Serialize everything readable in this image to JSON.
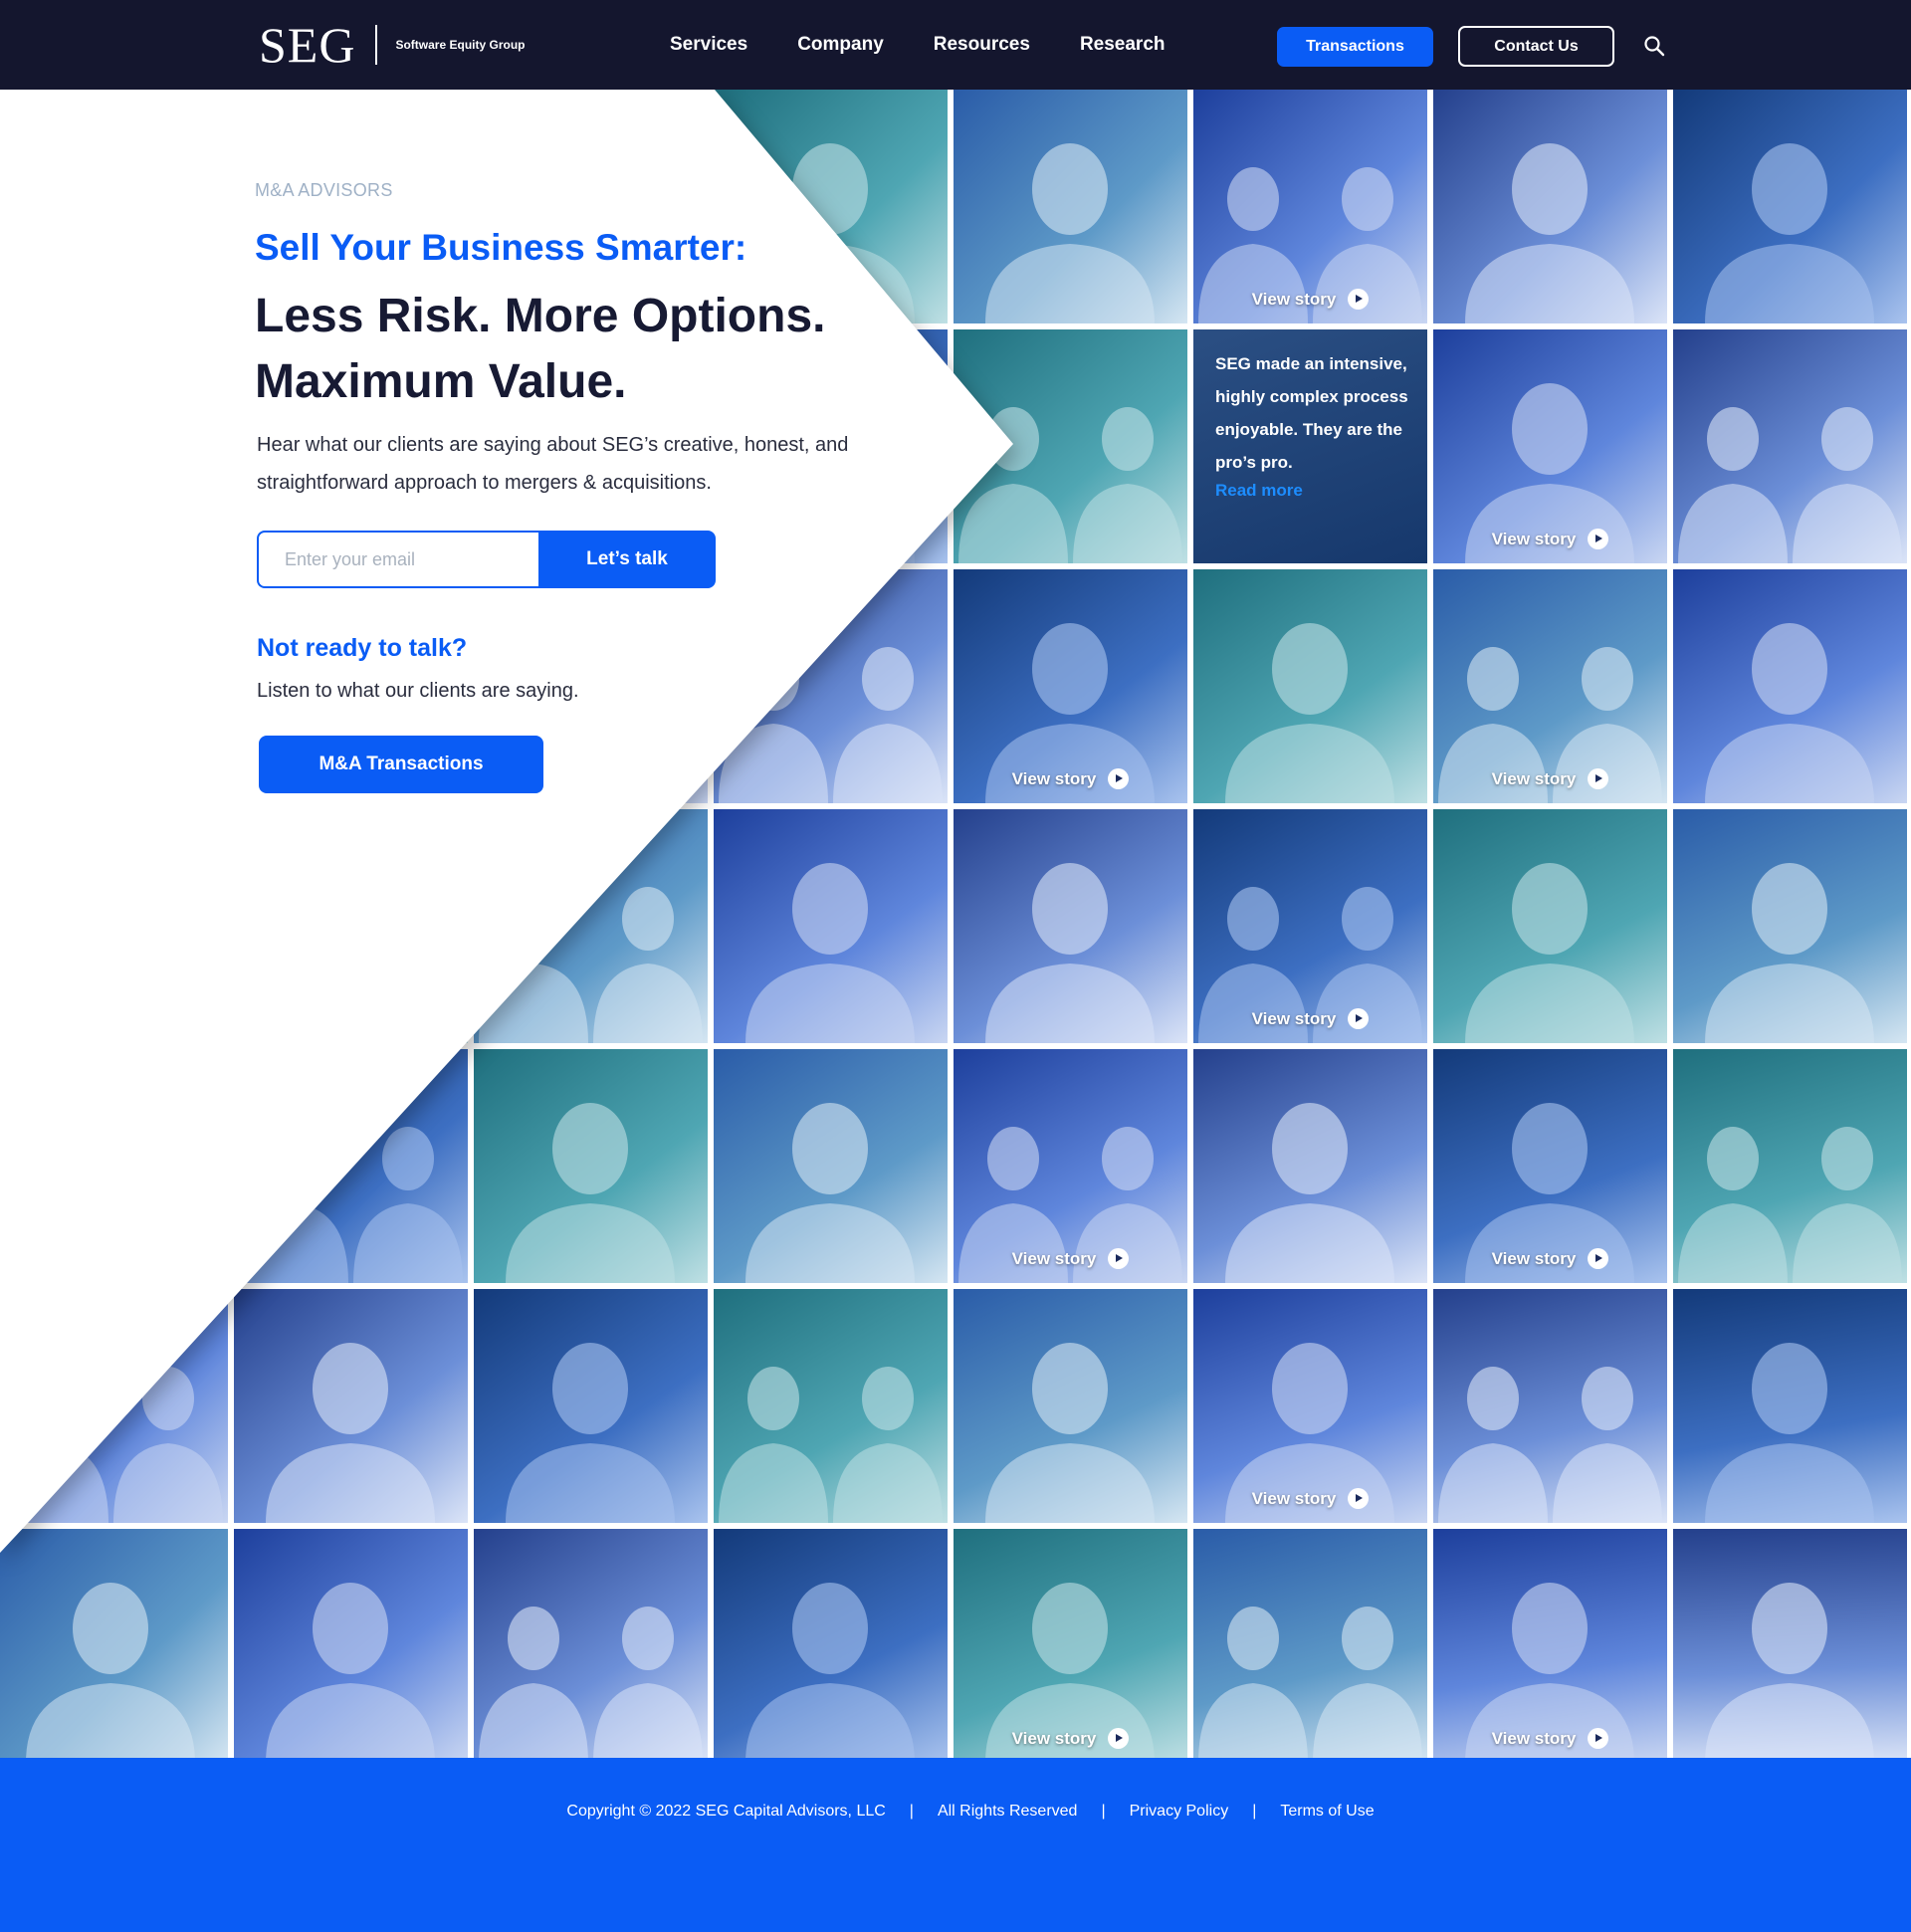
{
  "header": {
    "logo_mark": "SEG",
    "logo_sub": "Software Equity Group",
    "nav": [
      "Services",
      "Company",
      "Resources",
      "Research"
    ],
    "transactions_label": "Transactions",
    "contact_label": "Contact Us",
    "search_icon": "search-icon"
  },
  "hero": {
    "eyebrow": "M&A ADVISORS",
    "title_blue": "Sell Your Business Smarter:",
    "title_dark_1": "Less Risk. More Options.",
    "title_dark_2": "Maximum Value.",
    "lead": "Hear what our clients are saying about SEG’s creative, honest, and straightforward approach to mergers & acquisitions.",
    "email_placeholder": "Enter your email",
    "email_value": "",
    "email_button": "Let’s talk",
    "sub_heading": "Not ready to talk?",
    "sub_text": "Listen to what our clients are saying.",
    "ma_button": "M&A Transactions"
  },
  "grid": {
    "view_story_label": "View story",
    "quote_text": "SEG made an intensive, highly complex process enjoyable. They are the pro’s pro.",
    "quote_link": "Read more",
    "play_icon": "play-circle-icon"
  },
  "colors": {
    "navy": "#14162e",
    "accent_blue": "#0a5cf5",
    "tile_blue": "#2f55b8",
    "tile_teal": "#2a8a96",
    "link_blue": "#1d8dff"
  },
  "footer": {
    "copyright": "Copyright © 2022 SEG Capital Advisors, LLC",
    "rights": "All Rights Reserved",
    "privacy": "Privacy Policy",
    "terms": "Terms of Use",
    "separator": "|"
  }
}
